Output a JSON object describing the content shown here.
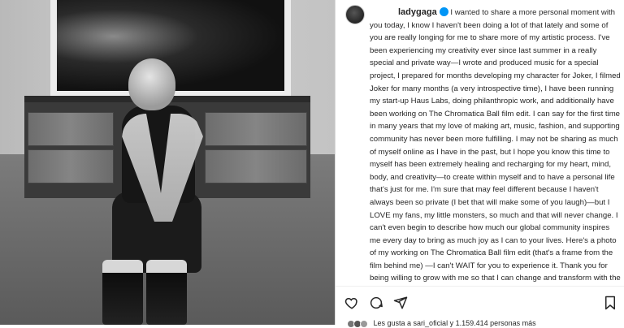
{
  "post": {
    "username": "ladygaga",
    "caption": "I wanted to share a more personal moment with you today, I know I haven't been doing a lot of that lately and some of you are really longing for me to share more of my artistic process. I've been experiencing my creativity ever since last summer in a really special and private way—I wrote and produced music for a special project, I prepared for months developing my character for Joker, I filmed Joker for many months (a very introspective time), I have been running my start-up Haus Labs, doing philanthropic work, and additionally have been working on The Chromatica Ball film edit. I can say for the first time in many years that my love of making art, music, fashion, and supporting community has never been more fulfilling. I may not be sharing as much of myself online as I have in the past, but I hope you know this time to myself has been extremely healing and recharging for my heart, mind, body, and creativity—to create within myself and to have a personal life that's just for me. I'm sure that may feel different because I haven't always been so private (I bet that will make some of you laugh)—but I LOVE my fans, my little monsters, so much and that will never change. I can't even begin to describe how much our global community inspires me every day to bring as much joy as I can to your lives. Here's a photo of my working on The Chromatica Ball film edit (that's a frame from the film behind me) —I can't WAIT for you to experience it. Thank you for being willing to grow with me so that I can change and transform with the community I love so much. I hope you love all the things I've",
    "likes_text": "Les gusta a sari_oficial y 1.159.414 personas más"
  },
  "icons": {
    "like": "heart-icon",
    "comment": "comment-icon",
    "share": "send-icon",
    "save": "bookmark-icon",
    "verified": "verified-badge-icon"
  },
  "colors": {
    "verified": "#0095f6",
    "text": "#262626"
  }
}
